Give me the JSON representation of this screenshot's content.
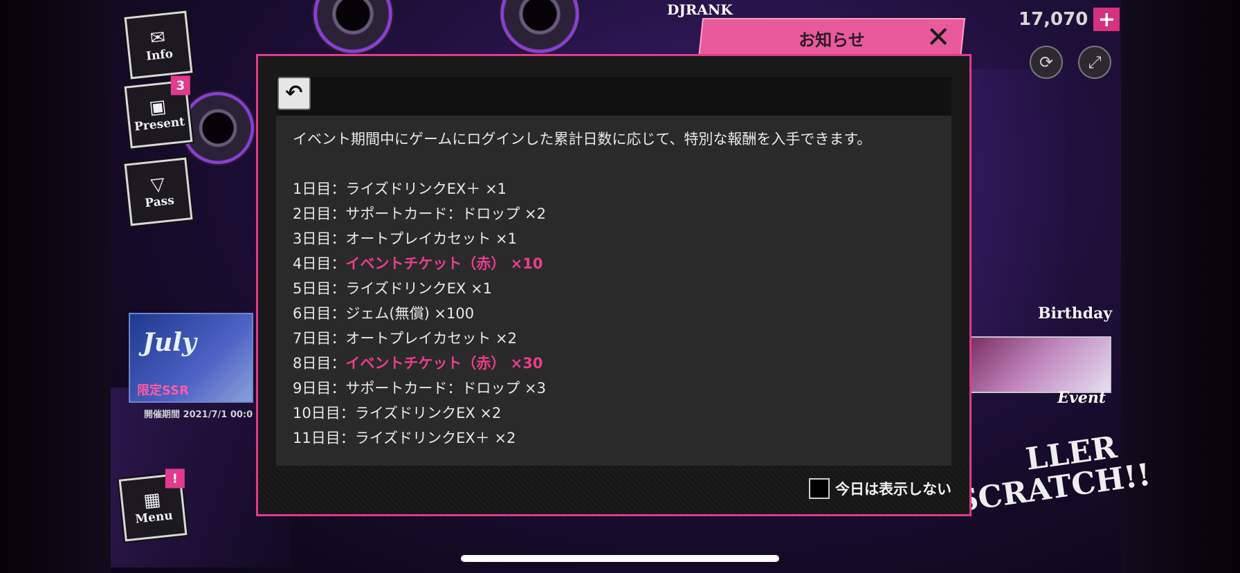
{
  "header": {
    "rank_label": "DJRANK",
    "currency_amount": "17,070",
    "currency_add_icon": "plus-icon",
    "refresh_icon": "refresh-icon",
    "fullscreen_icon": "expand-icon"
  },
  "sidebar": {
    "items": [
      {
        "label": "Info",
        "icon": "mail-icon"
      },
      {
        "label": "Present",
        "icon": "gift-box-icon",
        "badge": "3"
      },
      {
        "label": "Pass",
        "icon": "pass-icon"
      },
      {
        "label": "Menu",
        "icon": "grid-menu-icon",
        "badge": "!"
      }
    ]
  },
  "banners": {
    "left": {
      "title": "July",
      "subtitle": "限定SSR",
      "date_text": "開催期間 2021/7/1 00:0"
    },
    "right_event_label": "Event",
    "birthday_label": "Birthday",
    "scratch_text": "LLER SCRATCH!!"
  },
  "dialog": {
    "title": "お知らせ",
    "close_icon": "close-icon",
    "back_icon": "back-arrow-icon",
    "intro": "イベント期間中にゲームにログインした累計日数に応じて、特別な報酬を入手できます。",
    "rewards": [
      {
        "day": "1日目：",
        "item": "ライズドリンクEX＋ ×1",
        "highlight": false
      },
      {
        "day": "2日目：",
        "item": "サポートカード：ドロップ ×2",
        "highlight": false
      },
      {
        "day": "3日目：",
        "item": "オートプレイカセット ×1",
        "highlight": false
      },
      {
        "day": "4日目：",
        "item": "イベントチケット（赤） ×10",
        "highlight": true
      },
      {
        "day": "5日目：",
        "item": "ライズドリンクEX ×1",
        "highlight": false
      },
      {
        "day": "6日目：",
        "item": "ジェム(無償) ×100",
        "highlight": false
      },
      {
        "day": "7日目：",
        "item": "オートプレイカセット ×2",
        "highlight": false
      },
      {
        "day": "8日目：",
        "item": "イベントチケット（赤） ×30",
        "highlight": true
      },
      {
        "day": "9日目：",
        "item": "サポートカード：ドロップ ×3",
        "highlight": false
      },
      {
        "day": "10日目：",
        "item": "ライズドリンクEX ×2",
        "highlight": false
      },
      {
        "day": "11日目：",
        "item": "ライズドリンクEX＋ ×2",
        "highlight": false
      }
    ],
    "dont_show_today": "今日は表示しない",
    "dont_show_checked": false
  },
  "colors": {
    "accent": "#e23a8c",
    "highlight_text": "#ec3d8e"
  }
}
